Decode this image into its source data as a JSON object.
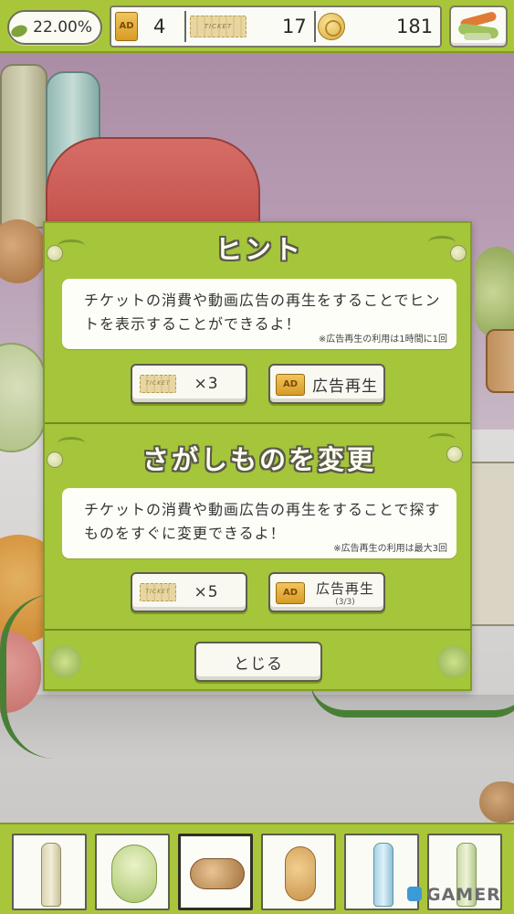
{
  "hud": {
    "progress_percent": "22.00%",
    "ad_count": "4",
    "ad_icon_text": "AD",
    "ticket_icon_text": "TICKET",
    "ticket_count": "17",
    "coin_count": "181"
  },
  "hint_section": {
    "title": "ヒント",
    "description": "チケットの消費や動画広告の再生をすることでヒントを表示することができるよ！",
    "note": "※広告再生の利用は1時間に1回",
    "ticket_button_label": "×3",
    "ad_button_label": "広告再生"
  },
  "change_section": {
    "title": "さがしものを変更",
    "description": "チケットの消費や動画広告の再生をすることで探すものをすぐに変更できるよ！",
    "note": "※広告再生の利用は最大3回",
    "ticket_button_label": "×5",
    "ad_button_label": "広告再生",
    "ad_button_sub": "(3/3)"
  },
  "close_button_label": "とじる",
  "inventory": {
    "items": [
      {
        "icon": "bottle-icon"
      },
      {
        "icon": "cabbage-icon"
      },
      {
        "icon": "walnut-icon",
        "selected": true
      },
      {
        "icon": "peanut-icon"
      },
      {
        "icon": "blue-bottle-icon"
      },
      {
        "icon": "green-bottle-icon"
      }
    ]
  },
  "watermark": "GAMER",
  "colors": {
    "panel_green": "#a5c53a",
    "hud_green": "#a9c63a",
    "button_bg": "#f9f9f1",
    "sky_purple": "#b99ab4"
  }
}
